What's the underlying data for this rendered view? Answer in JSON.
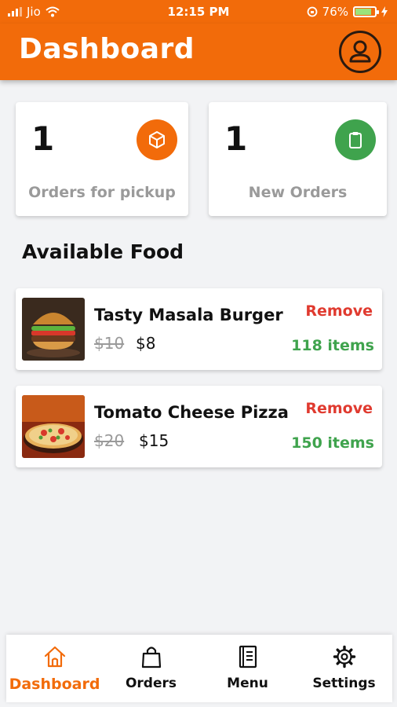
{
  "status_bar": {
    "carrier": "Jio",
    "time": "12:15 PM",
    "battery": "76%"
  },
  "header": {
    "title": "Dashboard",
    "profile_icon": "user-icon"
  },
  "stats": [
    {
      "value": "1",
      "label": "Orders for pickup",
      "icon": "box-icon",
      "color": "#f26b0a"
    },
    {
      "value": "1",
      "label": "New Orders",
      "icon": "clipboard-icon",
      "color": "#3fa34d"
    }
  ],
  "section_title": "Available Food",
  "foods": [
    {
      "name": "Tasty Masala Burger",
      "old_price": "$10",
      "price": "$8",
      "action": "Remove",
      "stock": "118 items"
    },
    {
      "name": "Tomato Cheese Pizza",
      "old_price": "$20",
      "price": "$15",
      "action": "Remove",
      "stock": "150 items"
    }
  ],
  "nav": [
    {
      "label": "Dashboard",
      "icon": "home-icon",
      "active": true
    },
    {
      "label": "Orders",
      "icon": "shopping-bag-icon",
      "active": false
    },
    {
      "label": "Menu",
      "icon": "menu-book-icon",
      "active": false
    },
    {
      "label": "Settings",
      "icon": "gear-icon",
      "active": false
    }
  ],
  "colors": {
    "primary": "#f26b0a",
    "success": "#3fa34d",
    "danger": "#e03a2f"
  }
}
